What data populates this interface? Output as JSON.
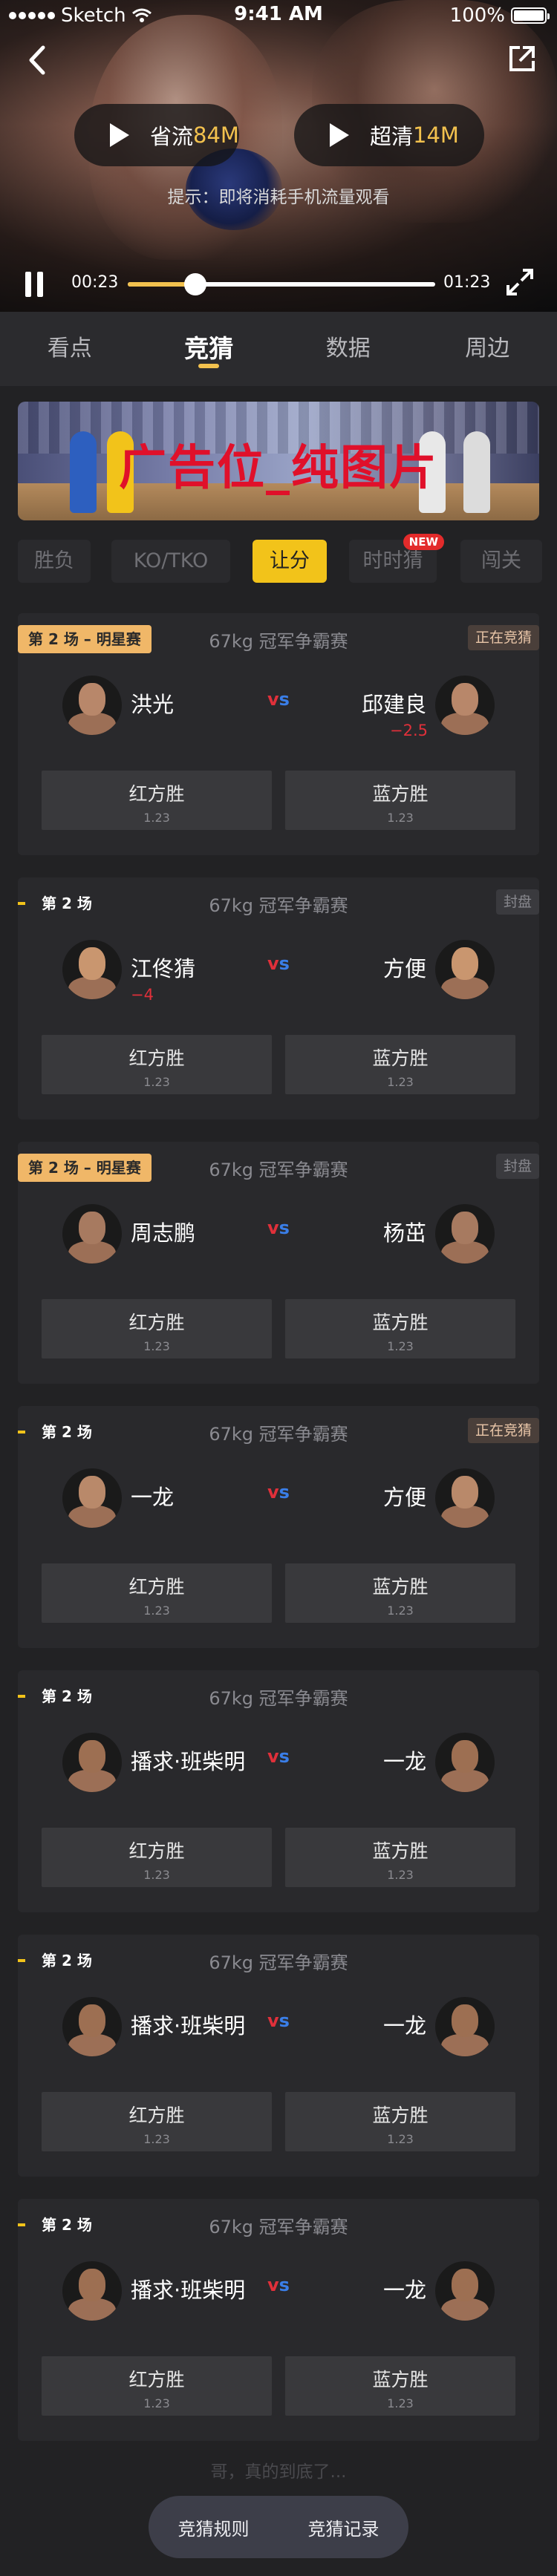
{
  "status_bar": {
    "carrier": "Sketch",
    "time": "9:41 AM",
    "battery": "100%"
  },
  "video": {
    "quality_options": [
      {
        "label": "省流",
        "size": "84M"
      },
      {
        "label": "超清",
        "size": "14M"
      }
    ],
    "hint": "提示：即将消耗手机流量观看",
    "current_time": "00:23",
    "total_time": "01:23",
    "progress": 0.22
  },
  "tabs": [
    "看点",
    "竞猜",
    "数据",
    "周边"
  ],
  "active_tab": 1,
  "banner_text": "广告位_纯图片",
  "sub_tabs": [
    "胜负",
    "KO/TKO",
    "让分",
    "时时猜",
    "闯关"
  ],
  "active_sub_tab": 2,
  "new_badge": "NEW",
  "cards": [
    {
      "round": "第 2 场 – 明星赛",
      "star": true,
      "title": "67kg 冠军争霸赛",
      "state": "正在竞猜",
      "state_type": "live",
      "red": "洪光",
      "blue": "邱建良",
      "red_handicap": "",
      "blue_handicap": "−2.5",
      "red_label": "红方胜",
      "blue_label": "蓝方胜",
      "red_odds": "1.23",
      "blue_odds": "1.23"
    },
    {
      "round": "第 2 场",
      "star": false,
      "title": "67kg 冠军争霸赛",
      "state": "封盘",
      "state_type": "closed",
      "red": "江佟猜",
      "blue": "方便",
      "red_handicap": "−4",
      "blue_handicap": "",
      "red_label": "红方胜",
      "blue_label": "蓝方胜",
      "red_odds": "1.23",
      "blue_odds": "1.23"
    },
    {
      "round": "第 2 场 – 明星赛",
      "star": true,
      "title": "67kg 冠军争霸赛",
      "state": "封盘",
      "state_type": "closed",
      "red": "周志鹏",
      "blue": "杨茁",
      "red_handicap": "",
      "blue_handicap": "",
      "red_label": "红方胜",
      "blue_label": "蓝方胜",
      "red_odds": "1.23",
      "blue_odds": "1.23"
    },
    {
      "round": "第 2 场",
      "star": false,
      "title": "67kg 冠军争霸赛",
      "state": "正在竞猜",
      "state_type": "live",
      "red": "一龙",
      "blue": "方便",
      "red_handicap": "",
      "blue_handicap": "",
      "red_label": "红方胜",
      "blue_label": "蓝方胜",
      "red_odds": "1.23",
      "blue_odds": "1.23"
    },
    {
      "round": "第 2 场",
      "star": false,
      "title": "67kg 冠军争霸赛",
      "state": "",
      "state_type": "none",
      "red": "播求·班柴明",
      "blue": "一龙",
      "red_handicap": "",
      "blue_handicap": "",
      "red_label": "红方胜",
      "blue_label": "蓝方胜",
      "red_odds": "1.23",
      "blue_odds": "1.23"
    },
    {
      "round": "第 2 场",
      "star": false,
      "title": "67kg 冠军争霸赛",
      "state": "",
      "state_type": "none",
      "red": "播求·班柴明",
      "blue": "一龙",
      "red_handicap": "",
      "blue_handicap": "",
      "red_label": "红方胜",
      "blue_label": "蓝方胜",
      "red_odds": "1.23",
      "blue_odds": "1.23"
    },
    {
      "round": "第 2 场",
      "star": false,
      "title": "67kg 冠军争霸赛",
      "state": "",
      "state_type": "none",
      "red": "播求·班柴明",
      "blue": "一龙",
      "red_handicap": "",
      "blue_handicap": "",
      "red_label": "红方胜",
      "blue_label": "蓝方胜",
      "red_odds": "1.23",
      "blue_odds": "1.23"
    }
  ],
  "end_text": "哥，真的到底了...",
  "bottom_nav": {
    "rules": "竞猜规则",
    "records": "竞猜记录"
  },
  "colors": {
    "accent": "#f2c31a",
    "red_side": "#e0303a",
    "blue_side": "#3a7ee8",
    "background": "#222224"
  }
}
